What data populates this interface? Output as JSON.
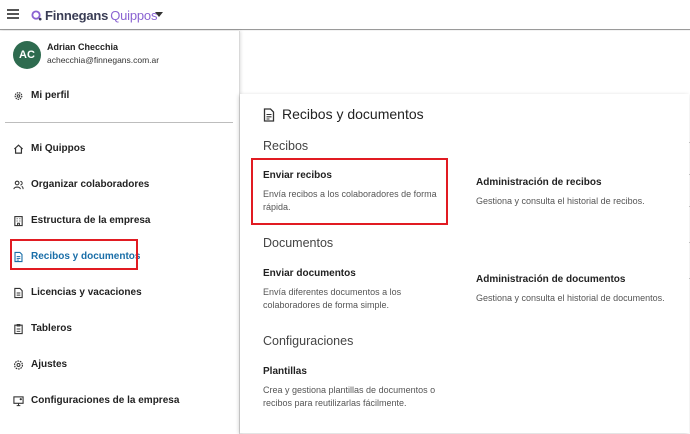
{
  "app": {
    "logo_primary": "Finnegans",
    "logo_secondary": "Quippos"
  },
  "user": {
    "initials": "AC",
    "name": "Adrian Checchia",
    "email": "achecchia@finnegans.com.ar",
    "avatar_color": "#2e6b4f"
  },
  "sidebar": {
    "profile_label": "Mi perfil",
    "items": [
      {
        "label": "Mi Quippos",
        "icon": "home-icon"
      },
      {
        "label": "Organizar colaboradores",
        "icon": "users-icon"
      },
      {
        "label": "Estructura de la empresa",
        "icon": "building-icon"
      },
      {
        "label": "Recibos y documentos",
        "icon": "document-icon",
        "active": true
      },
      {
        "label": "Licencias y vacaciones",
        "icon": "calendar-icon"
      },
      {
        "label": "Tableros",
        "icon": "clipboard-icon"
      },
      {
        "label": "Ajustes",
        "icon": "settings-icon"
      },
      {
        "label": "Configuraciones de la empresa",
        "icon": "monitor-settings-icon"
      }
    ]
  },
  "panel": {
    "title": "Recibos y documentos",
    "sections": [
      {
        "title": "Recibos",
        "cards": [
          {
            "title": "Enviar recibos",
            "desc": "Envía recibos a los colaboradores de forma rápida."
          },
          {
            "title": "Administración de recibos",
            "desc": "Gestiona y consulta el historial de recibos."
          }
        ]
      },
      {
        "title": "Documentos",
        "cards": [
          {
            "title": "Enviar documentos",
            "desc": "Envía diferentes documentos a los colaboradores de forma simple."
          },
          {
            "title": "Administración de documentos",
            "desc": "Gestiona y consulta el historial de documentos."
          }
        ]
      },
      {
        "title": "Configuraciones",
        "cards": [
          {
            "title": "Plantillas",
            "desc": "Crea y gestiona plantillas de documentos o recibos para reutilizarlas fácilmente."
          }
        ]
      }
    ]
  },
  "colors": {
    "accent": "#1a6ea8",
    "highlight": "#e11b22",
    "brand_purple": "#8a63d2"
  }
}
